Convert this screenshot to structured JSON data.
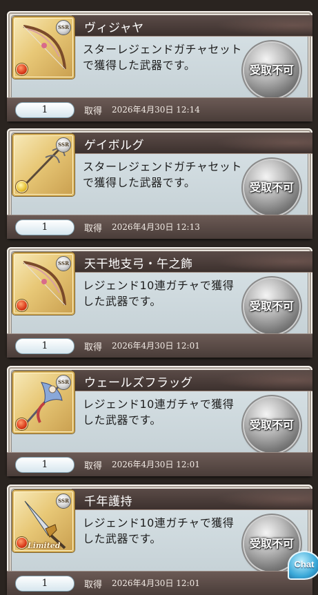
{
  "items": [
    {
      "name": "ヴィジャヤ",
      "description": "スターレジェンドガチャセットで獲得した武器です。",
      "rarity": "SSR",
      "element": "fire",
      "limited_label": "",
      "quantity": "1",
      "acquired_label": "取得",
      "acquired_at": "2026年4月30日 12:14",
      "claim_label": "受取不可",
      "weapon_icon": "bow-icon"
    },
    {
      "name": "ゲイボルグ",
      "description": "スターレジェンドガチャセットで獲得した武器です。",
      "rarity": "SSR",
      "element": "light",
      "limited_label": "",
      "quantity": "1",
      "acquired_label": "取得",
      "acquired_at": "2026年4月30日 12:13",
      "claim_label": "受取不可",
      "weapon_icon": "spear-icon"
    },
    {
      "name": "天干地支弓・午之飾",
      "description": "レジェンド10連ガチャで獲得した武器です。",
      "rarity": "SSR",
      "element": "fire",
      "limited_label": "",
      "quantity": "1",
      "acquired_label": "取得",
      "acquired_at": "2026年4月30日 12:01",
      "claim_label": "受取不可",
      "weapon_icon": "bow-icon"
    },
    {
      "name": "ウェールズフラッグ",
      "description": "レジェンド10連ガチャで獲得した武器です。",
      "rarity": "SSR",
      "element": "fire",
      "limited_label": "",
      "quantity": "1",
      "acquired_label": "取得",
      "acquired_at": "2026年4月30日 12:01",
      "claim_label": "受取不可",
      "weapon_icon": "flag-spear-icon"
    },
    {
      "name": "千年護持",
      "description": "レジェンド10連ガチャで獲得した武器です。",
      "rarity": "SSR",
      "element": "fire",
      "limited_label": "Limited",
      "quantity": "1",
      "acquired_label": "取得",
      "acquired_at": "2026年4月30日 12:01",
      "claim_label": "受取不可",
      "weapon_icon": "blade-icon"
    }
  ],
  "chat_button": {
    "label": "Chat",
    "icon": "chat-bubble-icon"
  },
  "colors": {
    "title_bar": "#3d312e",
    "card_body": "#d9e3e7",
    "footer_bar": "#4a3d39",
    "thumb_gold": "#e8c877",
    "button_silver": "#9a9a9a"
  }
}
